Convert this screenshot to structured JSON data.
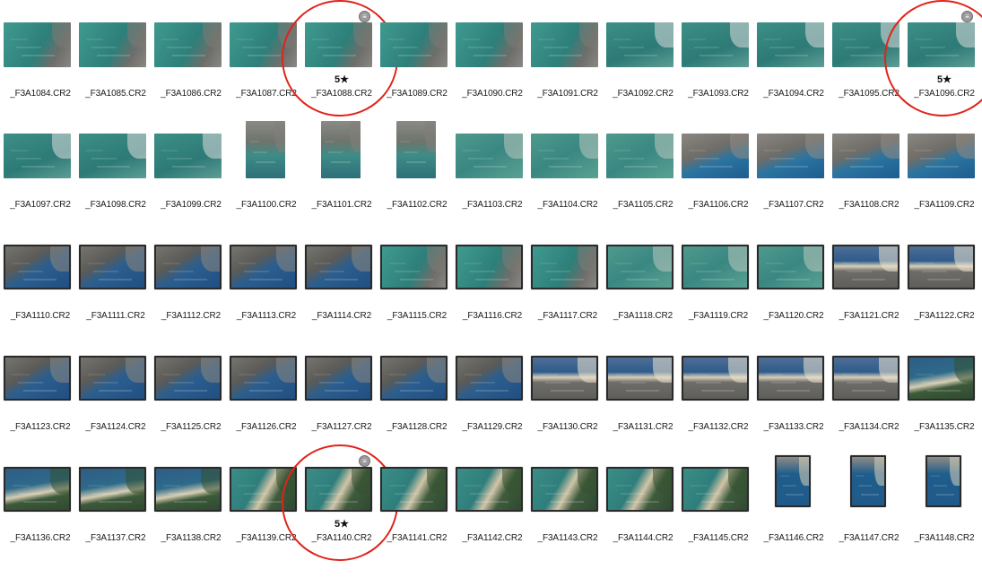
{
  "annotation_color": "#e0231b",
  "rating_text": "5★",
  "badge_icon": "adjustments-badge-icon",
  "files": [
    {
      "name": "_F3A1084.CR2",
      "style": "bay",
      "framed": false,
      "orient": "land"
    },
    {
      "name": "_F3A1085.CR2",
      "style": "bay",
      "framed": false,
      "orient": "land"
    },
    {
      "name": "_F3A1086.CR2",
      "style": "bay",
      "framed": false,
      "orient": "land"
    },
    {
      "name": "_F3A1087.CR2",
      "style": "bay",
      "framed": false,
      "orient": "land"
    },
    {
      "name": "_F3A1088.CR2",
      "style": "bay",
      "framed": false,
      "orient": "land",
      "rating": "5★",
      "badge": true,
      "circled": true
    },
    {
      "name": "_F3A1089.CR2",
      "style": "bay",
      "framed": false,
      "orient": "land"
    },
    {
      "name": "_F3A1090.CR2",
      "style": "bay",
      "framed": false,
      "orient": "land"
    },
    {
      "name": "_F3A1091.CR2",
      "style": "bay",
      "framed": false,
      "orient": "land"
    },
    {
      "name": "_F3A1092.CR2",
      "style": "pier",
      "framed": false,
      "orient": "land"
    },
    {
      "name": "_F3A1093.CR2",
      "style": "pier",
      "framed": false,
      "orient": "land"
    },
    {
      "name": "_F3A1094.CR2",
      "style": "pier",
      "framed": false,
      "orient": "land"
    },
    {
      "name": "_F3A1095.CR2",
      "style": "pier",
      "framed": false,
      "orient": "land"
    },
    {
      "name": "_F3A1096.CR2",
      "style": "pier",
      "framed": false,
      "orient": "land",
      "rating": "5★",
      "badge": true,
      "circled": true
    },
    {
      "name": "_F3A1097.CR2",
      "style": "pier",
      "framed": false,
      "orient": "land"
    },
    {
      "name": "_F3A1098.CR2",
      "style": "pier",
      "framed": false,
      "orient": "land"
    },
    {
      "name": "_F3A1099.CR2",
      "style": "pier",
      "framed": false,
      "orient": "land"
    },
    {
      "name": "_F3A1100.CR2",
      "style": "coast",
      "framed": false,
      "orient": "port"
    },
    {
      "name": "_F3A1101.CR2",
      "style": "coast",
      "framed": false,
      "orient": "port"
    },
    {
      "name": "_F3A1102.CR2",
      "style": "coast",
      "framed": false,
      "orient": "port"
    },
    {
      "name": "_F3A1103.CR2",
      "style": "shallow",
      "framed": false,
      "orient": "land"
    },
    {
      "name": "_F3A1104.CR2",
      "style": "shallow",
      "framed": false,
      "orient": "land"
    },
    {
      "name": "_F3A1105.CR2",
      "style": "shallow",
      "framed": false,
      "orient": "land"
    },
    {
      "name": "_F3A1106.CR2",
      "style": "town",
      "framed": false,
      "orient": "land"
    },
    {
      "name": "_F3A1107.CR2",
      "style": "town",
      "framed": false,
      "orient": "land"
    },
    {
      "name": "_F3A1108.CR2",
      "style": "town",
      "framed": false,
      "orient": "land"
    },
    {
      "name": "_F3A1109.CR2",
      "style": "town",
      "framed": false,
      "orient": "land"
    },
    {
      "name": "_F3A1110.CR2",
      "style": "deep",
      "framed": true,
      "orient": "land"
    },
    {
      "name": "_F3A1111.CR2",
      "style": "deep",
      "framed": true,
      "orient": "land"
    },
    {
      "name": "_F3A1112.CR2",
      "style": "deep",
      "framed": true,
      "orient": "land"
    },
    {
      "name": "_F3A1113.CR2",
      "style": "deep",
      "framed": true,
      "orient": "land"
    },
    {
      "name": "_F3A1114.CR2",
      "style": "deep",
      "framed": true,
      "orient": "land"
    },
    {
      "name": "_F3A1115.CR2",
      "style": "bay",
      "framed": true,
      "orient": "land"
    },
    {
      "name": "_F3A1116.CR2",
      "style": "bay",
      "framed": true,
      "orient": "land"
    },
    {
      "name": "_F3A1117.CR2",
      "style": "bay",
      "framed": true,
      "orient": "land"
    },
    {
      "name": "_F3A1118.CR2",
      "style": "shallow",
      "framed": true,
      "orient": "land"
    },
    {
      "name": "_F3A1119.CR2",
      "style": "shallow",
      "framed": true,
      "orient": "land"
    },
    {
      "name": "_F3A1120.CR2",
      "style": "shallow",
      "framed": true,
      "orient": "land"
    },
    {
      "name": "_F3A1121.CR2",
      "style": "beach",
      "framed": true,
      "orient": "land"
    },
    {
      "name": "_F3A1122.CR2",
      "style": "beach",
      "framed": true,
      "orient": "land"
    },
    {
      "name": "_F3A1123.CR2",
      "style": "deep",
      "framed": true,
      "orient": "land"
    },
    {
      "name": "_F3A1124.CR2",
      "style": "deep",
      "framed": true,
      "orient": "land"
    },
    {
      "name": "_F3A1125.CR2",
      "style": "deep",
      "framed": true,
      "orient": "land"
    },
    {
      "name": "_F3A1126.CR2",
      "style": "deep",
      "framed": true,
      "orient": "land"
    },
    {
      "name": "_F3A1127.CR2",
      "style": "deep",
      "framed": true,
      "orient": "land"
    },
    {
      "name": "_F3A1128.CR2",
      "style": "deep",
      "framed": true,
      "orient": "land"
    },
    {
      "name": "_F3A1129.CR2",
      "style": "deep",
      "framed": true,
      "orient": "land"
    },
    {
      "name": "_F3A1130.CR2",
      "style": "beach",
      "framed": true,
      "orient": "land"
    },
    {
      "name": "_F3A1131.CR2",
      "style": "beach",
      "framed": true,
      "orient": "land"
    },
    {
      "name": "_F3A1132.CR2",
      "style": "beach",
      "framed": true,
      "orient": "land"
    },
    {
      "name": "_F3A1133.CR2",
      "style": "beach",
      "framed": true,
      "orient": "land"
    },
    {
      "name": "_F3A1134.CR2",
      "style": "beach",
      "framed": true,
      "orient": "land"
    },
    {
      "name": "_F3A1135.CR2",
      "style": "head",
      "framed": true,
      "orient": "land"
    },
    {
      "name": "_F3A1136.CR2",
      "style": "head",
      "framed": true,
      "orient": "land"
    },
    {
      "name": "_F3A1137.CR2",
      "style": "head",
      "framed": true,
      "orient": "land"
    },
    {
      "name": "_F3A1138.CR2",
      "style": "head",
      "framed": true,
      "orient": "land"
    },
    {
      "name": "_F3A1139.CR2",
      "style": "forest",
      "framed": true,
      "orient": "land"
    },
    {
      "name": "_F3A1140.CR2",
      "style": "forest",
      "framed": true,
      "orient": "land",
      "rating": "5★",
      "badge": true,
      "circled": true
    },
    {
      "name": "_F3A1141.CR2",
      "style": "forest",
      "framed": true,
      "orient": "land"
    },
    {
      "name": "_F3A1142.CR2",
      "style": "forest",
      "framed": true,
      "orient": "land"
    },
    {
      "name": "_F3A1143.CR2",
      "style": "forest",
      "framed": true,
      "orient": "land"
    },
    {
      "name": "_F3A1144.CR2",
      "style": "forest",
      "framed": true,
      "orient": "land"
    },
    {
      "name": "_F3A1145.CR2",
      "style": "forest",
      "framed": true,
      "orient": "land"
    },
    {
      "name": "_F3A1146.CR2",
      "style": "cove",
      "framed": true,
      "orient": "port"
    },
    {
      "name": "_F3A1147.CR2",
      "style": "cove",
      "framed": true,
      "orient": "port"
    },
    {
      "name": "_F3A1148.CR2",
      "style": "cove",
      "framed": true,
      "orient": "port"
    }
  ]
}
